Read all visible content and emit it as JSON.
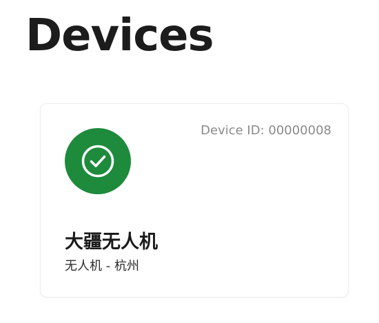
{
  "page": {
    "title": "Devices"
  },
  "device": {
    "id_label": "Device ID: 00000008",
    "status_icon": "check-circle-icon",
    "status_color": "#1e8a3c",
    "name": "大疆无人机",
    "subtitle": "无人机 - 杭州"
  }
}
